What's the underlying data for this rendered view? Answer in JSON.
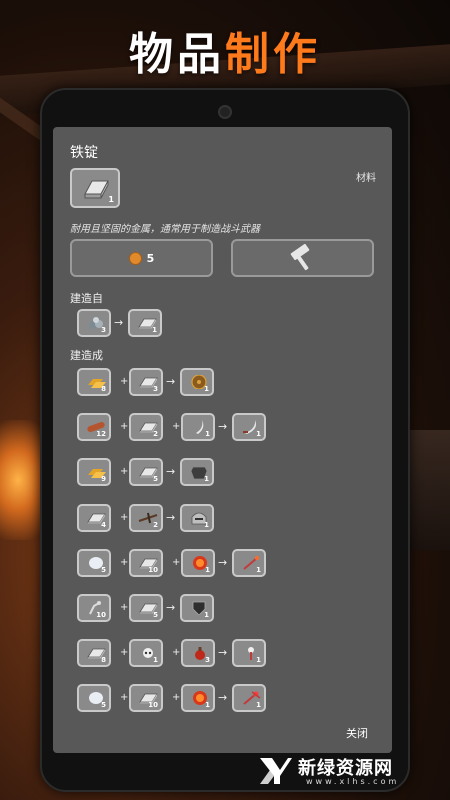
{
  "banner": {
    "title_part1": "物品",
    "title_part2": "制作"
  },
  "item": {
    "name": "铁锭",
    "category": "材料",
    "count": "1",
    "icon": "iron-ingot-icon",
    "description": "耐用且坚固的金属，通常用于制造战斗武器"
  },
  "actions": {
    "cost_value": "5",
    "cost_icon": "coin-icon",
    "craft_icon": "hammer-icon"
  },
  "built_from": {
    "label": "建造自",
    "inputs": [
      {
        "icon": "iron-ore-icon",
        "count": "3"
      }
    ],
    "output": {
      "icon": "iron-ingot-icon",
      "count": "1"
    }
  },
  "built_into": {
    "label": "建造成",
    "recipes": [
      {
        "inputs": [
          {
            "icon": "gold-ingot-icon",
            "count": "8"
          },
          {
            "icon": "iron-ingot-icon",
            "count": "3"
          }
        ],
        "output": {
          "icon": "round-shield-icon",
          "count": "1"
        }
      },
      {
        "inputs": [
          {
            "icon": "wood-log-icon",
            "count": "12"
          },
          {
            "icon": "iron-ingot-icon",
            "count": "2"
          },
          {
            "icon": "blade-icon",
            "count": "1"
          }
        ],
        "output": {
          "icon": "sword-icon",
          "count": "1"
        }
      },
      {
        "inputs": [
          {
            "icon": "gold-ingot-icon",
            "count": "9"
          },
          {
            "icon": "iron-ingot-icon",
            "count": "5"
          }
        ],
        "output": {
          "icon": "armor-icon",
          "count": "1"
        }
      },
      {
        "inputs": [
          {
            "icon": "iron-ingot-icon",
            "count": "4"
          },
          {
            "icon": "crossbow-icon",
            "count": "2"
          }
        ],
        "output": {
          "icon": "helmet-icon",
          "count": "1"
        }
      },
      {
        "inputs": [
          {
            "icon": "white-orb-icon",
            "count": "5"
          },
          {
            "icon": "iron-ingot-icon",
            "count": "10"
          },
          {
            "icon": "red-gem-icon",
            "count": "1"
          }
        ],
        "output": {
          "icon": "staff-icon",
          "count": "1"
        }
      },
      {
        "inputs": [
          {
            "icon": "bone-icon",
            "count": "10"
          },
          {
            "icon": "iron-ingot-icon",
            "count": "5"
          }
        ],
        "output": {
          "icon": "dark-shield-icon",
          "count": "1"
        }
      },
      {
        "inputs": [
          {
            "icon": "iron-ingot-icon",
            "count": "8"
          },
          {
            "icon": "skull-icon",
            "count": "1"
          },
          {
            "icon": "potion-icon",
            "count": "3"
          }
        ],
        "output": {
          "icon": "skull-staff-icon",
          "count": "1"
        }
      },
      {
        "inputs": [
          {
            "icon": "white-orb-icon",
            "count": "5"
          },
          {
            "icon": "iron-ingot-icon",
            "count": "10"
          },
          {
            "icon": "red-gem-icon",
            "count": "1"
          }
        ],
        "output": {
          "icon": "ruby-staff-icon",
          "count": "1"
        }
      }
    ]
  },
  "footer": {
    "close_label": "关闭"
  },
  "watermark": {
    "title": "新绿资源网",
    "subtitle": "www.xlhs.com",
    "icon": "xlhs-logo-icon"
  }
}
